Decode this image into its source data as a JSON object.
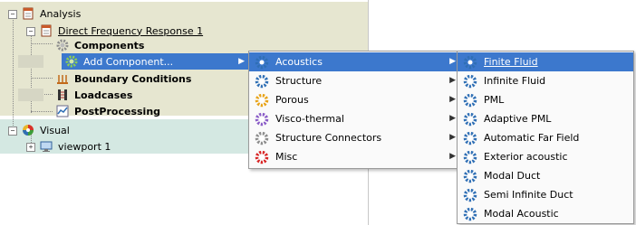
{
  "tree": {
    "analysis": "Analysis",
    "response": "Direct Frequency Response 1",
    "components": "Components",
    "add_component": "Add Component...",
    "boundary": "Boundary Conditions",
    "loadcases": "Loadcases",
    "postprocessing": "PostProcessing",
    "visual": "Visual",
    "viewport": "viewport 1",
    "expand_open": "−",
    "expand_closed": "+"
  },
  "menu1": {
    "items": [
      "Acoustics",
      "Structure",
      "Porous",
      "Visco-thermal",
      "Structure Connectors",
      "Misc"
    ],
    "submenu_arrow": "▶"
  },
  "menu2": {
    "items": [
      "Finite Fluid",
      "Infinite Fluid",
      "PML",
      "Adaptive PML",
      "Automatic Far Field",
      "Exterior acoustic",
      "Modal Duct",
      "Semi Infinite Duct",
      "Modal Acoustic"
    ]
  },
  "icons": {
    "gear_blue": "#2f6fb5",
    "gear_orange": "#e8a317",
    "gear_purple": "#8a5cc7",
    "gear_grey": "#8c8c8c",
    "gear_red": "#d82424",
    "highlight": "#3c78cd"
  }
}
